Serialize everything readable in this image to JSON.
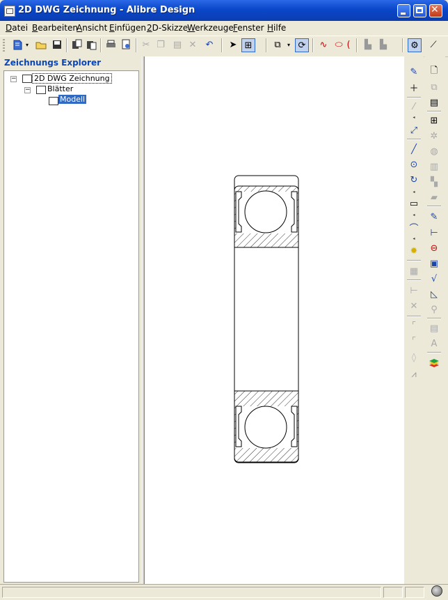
{
  "window": {
    "title": "2D DWG Zeichnung  - Alibre Design"
  },
  "menu": [
    "Datei",
    "Bearbeiten",
    "Ansicht",
    "Einfügen",
    "2D-Skizze",
    "Werkzeuge",
    "Fenster",
    "Hilfe"
  ],
  "explorer": {
    "title": "Zeichnungs Explorer",
    "tree": [
      {
        "label": "2D DWG Zeichnung",
        "state": "expanded",
        "toggle": "−"
      },
      {
        "label": "Blätter",
        "state": "expanded",
        "toggle": "−"
      },
      {
        "label": "Modell",
        "state": "selected"
      }
    ]
  },
  "toolbar_icons": [
    "new-icon",
    "open-icon",
    "save-icon",
    "copy-document-icon",
    "paste-document-icon",
    "print-icon",
    "print-preview-icon",
    "cut-icon",
    "copy-icon",
    "paste-icon",
    "delete-icon",
    "undo-icon",
    "select-pointer-icon",
    "select-window-icon",
    "insert-view-icon",
    "refresh-icon",
    "sketch-icon",
    "ellipse-icon",
    "properties-icon",
    "redline-icon"
  ],
  "sketch_tools": [
    "activate-sketch-icon",
    "point-icon",
    "construction-line-icon",
    "trim-icon",
    "extend-icon",
    "line-icon",
    "circle-icon",
    "arc-icon",
    "rectangle-icon",
    "fillet-sketch-icon",
    "ellipse-point-icon",
    "sketch-settings-icon",
    "dimension-icon",
    "perpendicular-icon",
    "parallel-icon",
    "chamfer-icon",
    "fillet-icon",
    "mirror-icon",
    "figure-icon"
  ],
  "drawing_tools": [
    "insert-sheet-icon",
    "duplicate-sheet-icon",
    "sheet-format-icon",
    "standard-views-icon",
    "projected-view-icon",
    "section-view-icon",
    "detail-view-icon",
    "broken-view-icon",
    "auxiliary-view-icon",
    "note-icon",
    "center-mark-icon",
    "center-line-icon",
    "datum-icon",
    "surface-finish-icon",
    "weld-symbol-icon",
    "zoom-icon",
    "balloon-icon",
    "text-icon",
    "layers-icon"
  ],
  "colors": {
    "titlebar": "#0a47c9",
    "chrome": "#ece9d8",
    "selection": "#316ac5",
    "explorer_title": "#0a46b6"
  }
}
